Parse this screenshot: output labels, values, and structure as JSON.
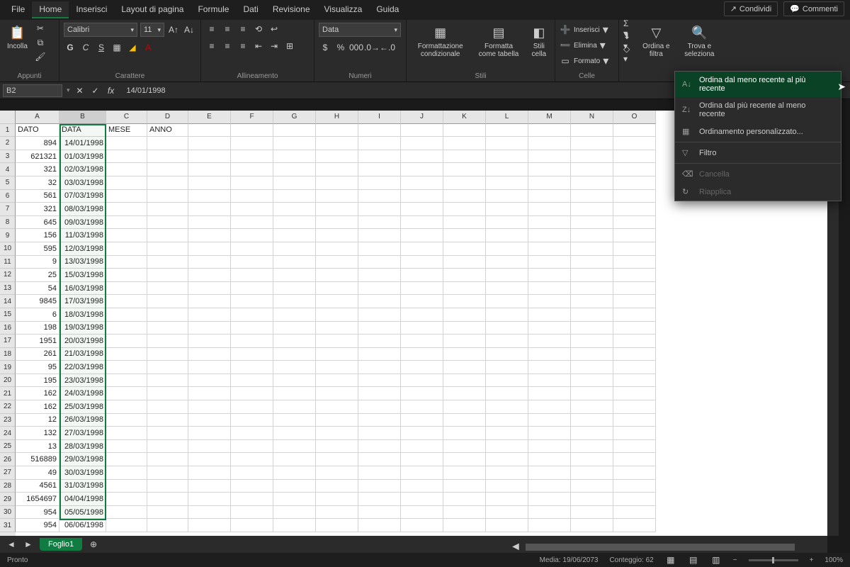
{
  "tabs": [
    "File",
    "Home",
    "Inserisci",
    "Layout di pagina",
    "Formule",
    "Dati",
    "Revisione",
    "Visualizza",
    "Guida"
  ],
  "activeTab": 1,
  "share": "Condividi",
  "comments": "Commenti",
  "clipboard": {
    "paste": "Incolla",
    "label": "Appunti"
  },
  "font": {
    "name": "Calibri",
    "size": "11",
    "label": "Carattere"
  },
  "align": {
    "label": "Allineamento"
  },
  "number": {
    "format": "Data",
    "label": "Numeri"
  },
  "styles": {
    "cond": "Formattazione condizionale",
    "table": "Formatta come tabella",
    "cell": "Stili cella",
    "label": "Stili"
  },
  "cells": {
    "insert": "Inserisci",
    "delete": "Elimina",
    "format": "Formato",
    "label": "Celle"
  },
  "editing": {
    "sort": "Ordina e filtra",
    "find": "Trova e seleziona"
  },
  "namebox": "B2",
  "formula": "14/01/1998",
  "cols": [
    "A",
    "B",
    "C",
    "D",
    "E",
    "F",
    "G",
    "H",
    "I",
    "J",
    "K",
    "L",
    "M",
    "N",
    "O"
  ],
  "headers": {
    "a": "DATO",
    "b": "DATA",
    "c": "MESE",
    "d": "ANNO"
  },
  "rows": [
    {
      "n": 2,
      "a": "894",
      "b": "14/01/1998"
    },
    {
      "n": 3,
      "a": "621321",
      "b": "01/03/1998"
    },
    {
      "n": 4,
      "a": "321",
      "b": "02/03/1998"
    },
    {
      "n": 5,
      "a": "32",
      "b": "03/03/1998"
    },
    {
      "n": 6,
      "a": "561",
      "b": "07/03/1998"
    },
    {
      "n": 7,
      "a": "321",
      "b": "08/03/1998"
    },
    {
      "n": 8,
      "a": "645",
      "b": "09/03/1998"
    },
    {
      "n": 9,
      "a": "156",
      "b": "11/03/1998"
    },
    {
      "n": 10,
      "a": "595",
      "b": "12/03/1998"
    },
    {
      "n": 11,
      "a": "9",
      "b": "13/03/1998"
    },
    {
      "n": 12,
      "a": "25",
      "b": "15/03/1998"
    },
    {
      "n": 13,
      "a": "54",
      "b": "16/03/1998"
    },
    {
      "n": 14,
      "a": "9845",
      "b": "17/03/1998"
    },
    {
      "n": 15,
      "a": "6",
      "b": "18/03/1998"
    },
    {
      "n": 16,
      "a": "198",
      "b": "19/03/1998"
    },
    {
      "n": 17,
      "a": "1951",
      "b": "20/03/1998"
    },
    {
      "n": 18,
      "a": "261",
      "b": "21/03/1998"
    },
    {
      "n": 19,
      "a": "95",
      "b": "22/03/1998"
    },
    {
      "n": 20,
      "a": "195",
      "b": "23/03/1998"
    },
    {
      "n": 21,
      "a": "162",
      "b": "24/03/1998"
    },
    {
      "n": 22,
      "a": "162",
      "b": "25/03/1998"
    },
    {
      "n": 23,
      "a": "12",
      "b": "26/03/1998"
    },
    {
      "n": 24,
      "a": "132",
      "b": "27/03/1998"
    },
    {
      "n": 25,
      "a": "13",
      "b": "28/03/1998"
    },
    {
      "n": 26,
      "a": "516889",
      "b": "29/03/1998"
    },
    {
      "n": 27,
      "a": "49",
      "b": "30/03/1998"
    },
    {
      "n": 28,
      "a": "4561",
      "b": "31/03/1998"
    },
    {
      "n": 29,
      "a": "1654697",
      "b": "04/04/1998"
    },
    {
      "n": 30,
      "a": "954",
      "b": "05/05/1998"
    },
    {
      "n": 31,
      "a": "954",
      "b": "06/06/1998"
    }
  ],
  "dropdown": {
    "sortAsc": "Ordina dal meno recente al più recente",
    "sortDesc": "Ordina dal più recente al meno recente",
    "custom": "Ordinamento personalizzato...",
    "filter": "Filtro",
    "clear": "Cancella",
    "reapply": "Riapplica"
  },
  "sheet": "Foglio1",
  "status": {
    "ready": "Pronto",
    "avg": "Media: 19/06/2073",
    "count": "Conteggio: 62",
    "zoom": "100%"
  }
}
